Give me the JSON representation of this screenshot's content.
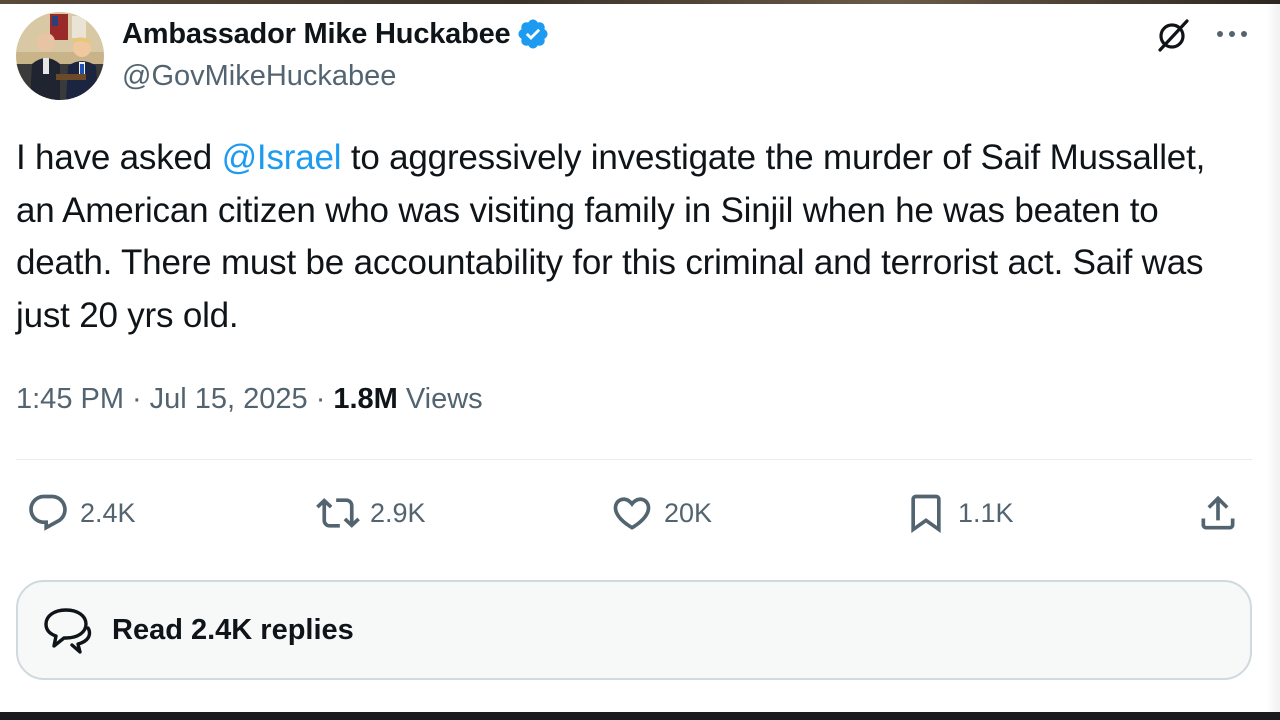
{
  "author": {
    "display_name": "Ambassador Mike Huckabee",
    "handle": "@GovMikeHuckabee",
    "verified": true,
    "verified_color": "#1d9bf0"
  },
  "tweet": {
    "text_before_mention": "I have asked ",
    "mention": "@Israel",
    "text_after_mention": " to aggressively investigate the murder of Saif Mussallet, an American citizen who was visiting family in Sinjil when he was beaten to death. There must be accountability for this criminal and terrorist act.  Saif was just 20 yrs old.",
    "time": "1:45 PM",
    "date": "Jul 15, 2025",
    "views_count": "1.8M",
    "views_label": "Views",
    "separator": "·"
  },
  "actions": {
    "replies": "2.4K",
    "reposts": "2.9K",
    "likes": "20K",
    "bookmarks": "1.1K"
  },
  "read_replies_label": "Read 2.4K replies",
  "icons": {
    "grok": "grok-icon",
    "more": "more-icon",
    "reply": "reply-icon",
    "retweet": "retweet-icon",
    "like": "heart-icon",
    "bookmark": "bookmark-icon",
    "share": "share-icon",
    "read_replies": "chat-bubbles-icon"
  },
  "colors": {
    "text": "#0f1419",
    "secondary": "#536471",
    "link": "#1d9bf0"
  }
}
